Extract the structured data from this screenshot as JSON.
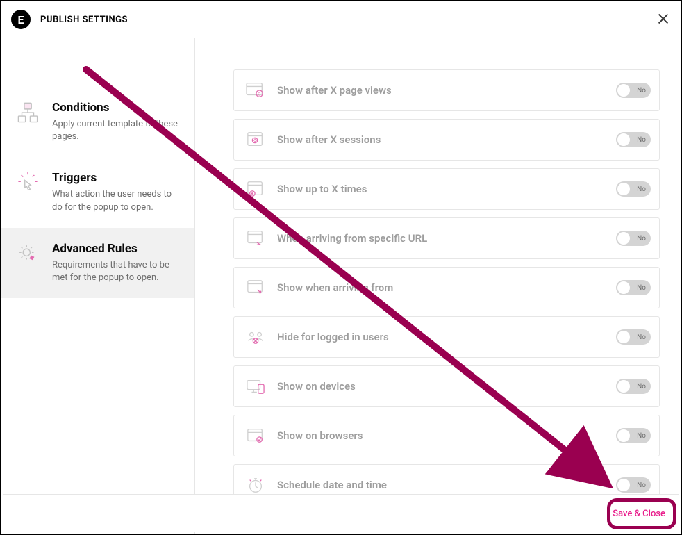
{
  "header": {
    "title": "PUBLISH SETTINGS"
  },
  "sidebar": {
    "items": [
      {
        "title": "Conditions",
        "desc": "Apply current template to these pages."
      },
      {
        "title": "Triggers",
        "desc": "What action the user needs to do for the popup to open."
      },
      {
        "title": "Advanced Rules",
        "desc": "Requirements that have to be met for the popup to open."
      }
    ]
  },
  "rules": [
    {
      "label": "Show after X page views",
      "state": "No"
    },
    {
      "label": "Show after X sessions",
      "state": "No"
    },
    {
      "label": "Show up to X times",
      "state": "No"
    },
    {
      "label": "When arriving from specific URL",
      "state": "No"
    },
    {
      "label": "Show when arriving from",
      "state": "No"
    },
    {
      "label": "Hide for logged in users",
      "state": "No"
    },
    {
      "label": "Show on devices",
      "state": "No"
    },
    {
      "label": "Show on browsers",
      "state": "No"
    },
    {
      "label": "Schedule date and time",
      "state": "No"
    }
  ],
  "footer": {
    "save_label": "Save & Close"
  }
}
